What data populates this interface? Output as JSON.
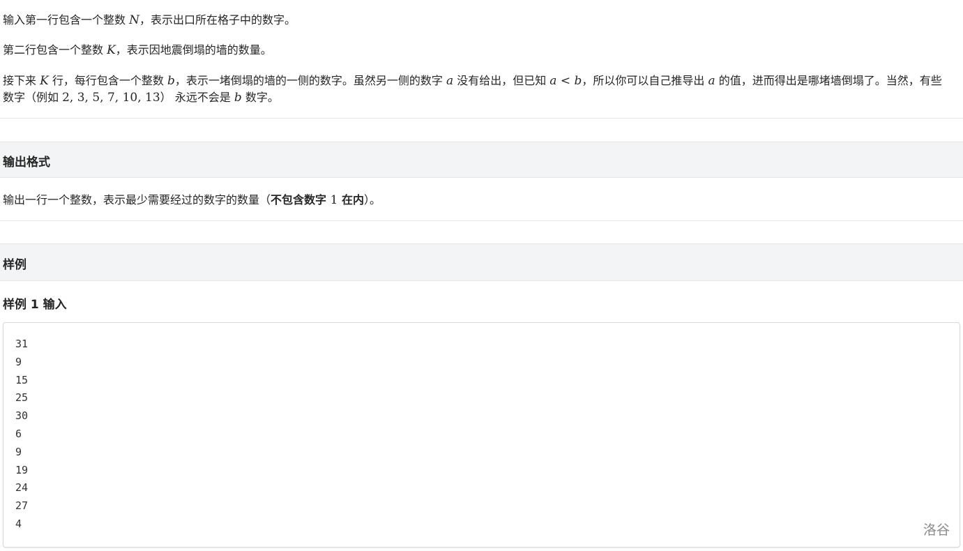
{
  "input_section": {
    "line1": {
      "before": "输入第一行包含一个整数 ",
      "var": "N",
      "after": "，表示出口所在格子中的数字。"
    },
    "line2": {
      "before": "第二行包含一个整数 ",
      "var": "K",
      "after": "，表示因地震倒塌的墙的数量。"
    },
    "line3": {
      "t1": "接下来 ",
      "v1": "K",
      "t2": " 行，每行包含一个整数 ",
      "v2": "b",
      "t3": "，表示一堵倒塌的墙的一侧的数字。虽然另一侧的数字 ",
      "v3": "a",
      "t4": " 没有给出，但已知 ",
      "v4": "a",
      "op": " < ",
      "v5": "b",
      "t5": "，所以你可以自己推导出 ",
      "v6": "a",
      "t6": " 的值，进而得出是哪堵墙倒塌了。当然，有些数字（例如 ",
      "nums": "2, 3, 5, 7, 10, 13",
      "t7": "） 永远不会是 ",
      "v7": "b",
      "t8": " 数字。"
    }
  },
  "output_section": {
    "title": "输出格式",
    "text_before": "输出一行一个整数，表示最少需要经过的数字的数量（",
    "bold1": "不包含数字 ",
    "num": "1",
    "bold2": " 在内",
    "text_after": "）。"
  },
  "sample_section": {
    "title": "样例",
    "sample_title": "样例 1 输入",
    "input_lines": [
      "31",
      "9",
      "15",
      "25",
      "30",
      "6",
      "9",
      "19",
      "24",
      "27",
      "4"
    ],
    "watermark": "洛谷"
  },
  "colors": {
    "header_bg": "#f3f4f6",
    "divider": "#e5e6eb",
    "text": "#262626",
    "watermark": "#8c8c8c"
  }
}
